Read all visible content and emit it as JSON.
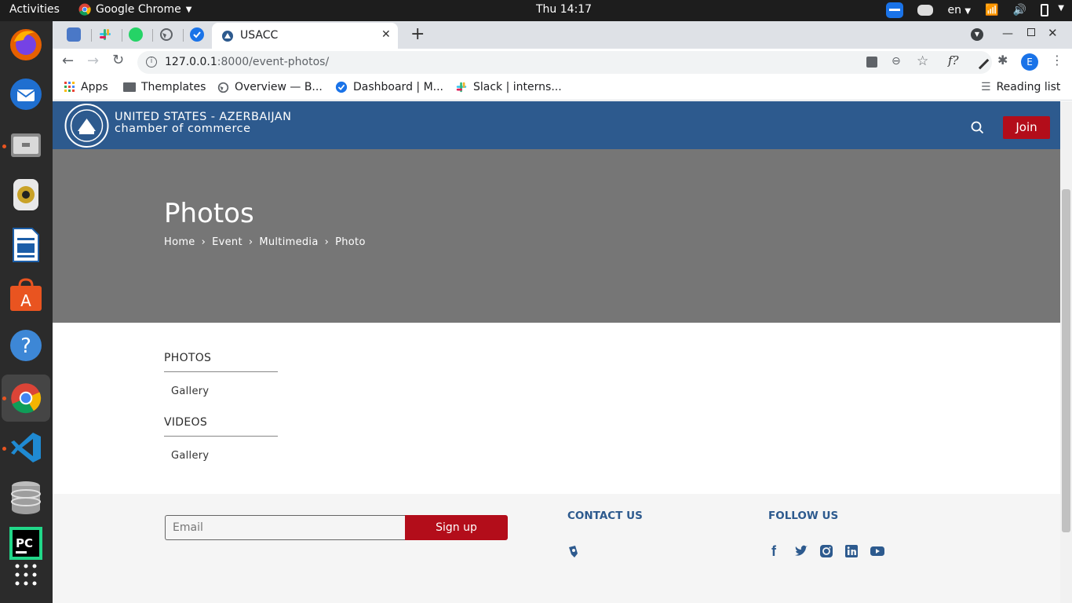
{
  "os": {
    "activities": "Activities",
    "app_name": "Google Chrome",
    "clock": "Thu 14:17",
    "language": "en"
  },
  "browser": {
    "active_tab_title": "USACC",
    "url_host": "127.0.0.1",
    "url_rest": ":8000/event-photos/",
    "profile_initial": "E",
    "bookmarks": [
      {
        "label": "Apps"
      },
      {
        "label": "Themplates"
      },
      {
        "label": "Overview — B..."
      },
      {
        "label": "Dashboard | M..."
      },
      {
        "label": "Slack | interns..."
      }
    ],
    "reading_list": "Reading list"
  },
  "site": {
    "brand_line1": "UNITED STATES - AZERBAIJAN",
    "brand_line2": "chamber of commerce",
    "join_label": "Join",
    "hero_title": "Photos",
    "breadcrumb": [
      "Home",
      "Event",
      "Multimedia",
      "Photo"
    ],
    "sidebar": {
      "photos_heading": "PHOTOS",
      "photos_link": "Gallery",
      "videos_heading": "VIDEOS",
      "videos_link": "Gallery"
    },
    "footer": {
      "email_placeholder": "Email",
      "signup_label": "Sign up",
      "contact_heading": "CONTACT US",
      "follow_heading": "FOLLOW US"
    }
  },
  "colors": {
    "header_blue": "#2d5a8e",
    "accent_red": "#b30d1a",
    "hero_gray": "#767676",
    "footer_heading": "#2d5a8e"
  }
}
